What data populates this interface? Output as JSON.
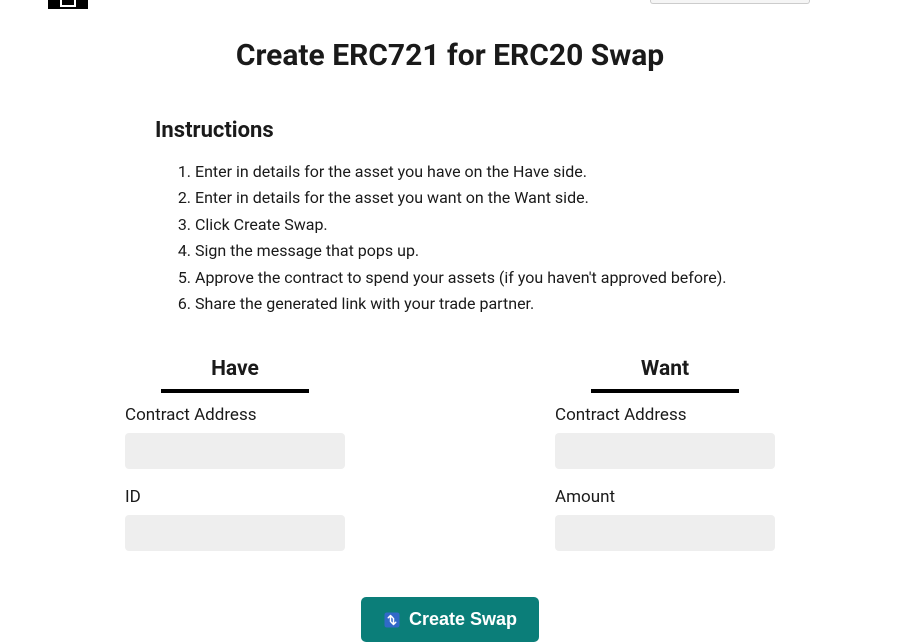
{
  "page": {
    "title": "Create ERC721 for ERC20 Swap"
  },
  "instructions": {
    "heading": "Instructions",
    "steps": [
      "Enter in details for the asset you have on the Have side.",
      "Enter in details for the asset you want on the Want side.",
      "Click Create Swap.",
      "Sign the message that pops up.",
      "Approve the contract to spend your assets (if you haven't approved before).",
      "Share the generated link with your trade partner."
    ]
  },
  "form": {
    "have": {
      "heading": "Have",
      "contract_label": "Contract Address",
      "contract_value": "",
      "second_label": "ID",
      "second_value": ""
    },
    "want": {
      "heading": "Want",
      "contract_label": "Contract Address",
      "contract_value": "",
      "second_label": "Amount",
      "second_value": ""
    }
  },
  "actions": {
    "create_label": "Create Swap"
  }
}
